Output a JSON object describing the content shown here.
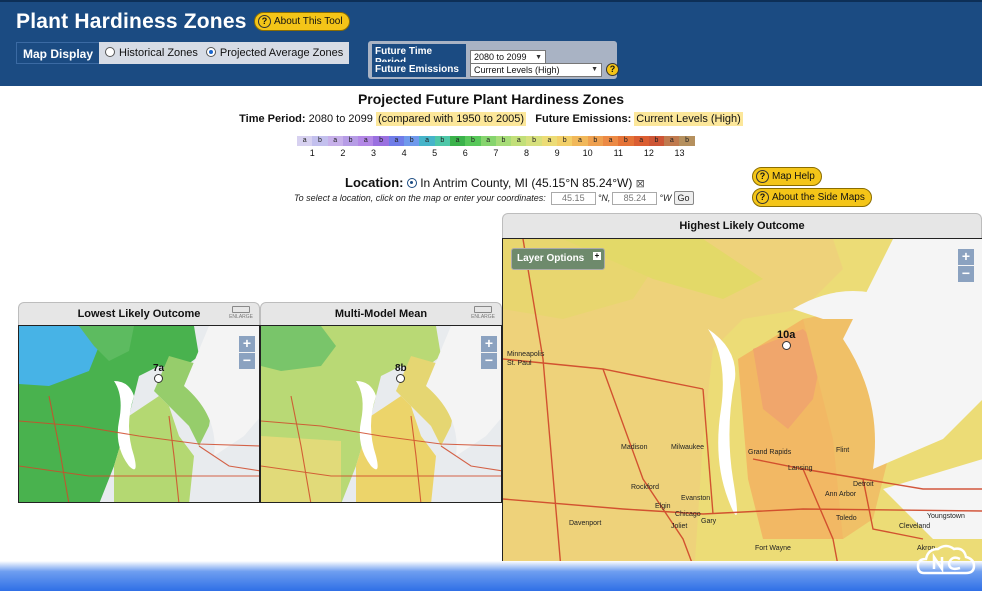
{
  "app": {
    "title": "Plant Hardiness Zones",
    "about_button": "About This Tool"
  },
  "map_display": {
    "label": "Map Display",
    "options": [
      "Historical Zones",
      "Projected Average Zones"
    ],
    "selected": "Projected Average Zones"
  },
  "future": {
    "time_period_label": "Future Time Period",
    "time_period_value": "2080 to 2099",
    "emissions_label": "Future Emissions",
    "emissions_value": "Current Levels (High)"
  },
  "main": {
    "title": "Projected Future Plant Hardiness Zones",
    "period_label": "Time Period:",
    "period_value": "2080 to 2099",
    "compared": "(compared with 1950 to 2005)",
    "emissions_label": "Future Emissions:",
    "emissions_value": "Current Levels (High)"
  },
  "legend": {
    "subzones": [
      "a",
      "b",
      "a",
      "b",
      "a",
      "b",
      "a",
      "b",
      "a",
      "b",
      "a",
      "b",
      "a",
      "b",
      "a",
      "b",
      "a",
      "b",
      "a",
      "b",
      "a",
      "b",
      "a",
      "b",
      "a",
      "b"
    ],
    "numbers": [
      "1",
      "2",
      "3",
      "4",
      "5",
      "6",
      "7",
      "8",
      "9",
      "10",
      "11",
      "12",
      "13"
    ],
    "colors": [
      "#d7d1f0",
      "#c3c0ee",
      "#c7b0ea",
      "#b69ce6",
      "#b387e6",
      "#9a70e0",
      "#6f7ce8",
      "#6f99ec",
      "#46b4c9",
      "#4ec7a8",
      "#3bb24b",
      "#58c85a",
      "#86d46e",
      "#a7dc78",
      "#c2df79",
      "#d7e07d",
      "#ecdc76",
      "#f2cf68",
      "#f1b85a",
      "#eea04f",
      "#ec8a45",
      "#e57337",
      "#db5e32",
      "#cd5535",
      "#c07a4e",
      "#b5905e"
    ]
  },
  "location": {
    "label": "Location:",
    "value": "In Antrim County, MI (45.15°N 85.24°W)",
    "instruction": "To select a location, click on the map or enter your coordinates:",
    "lat_placeholder": "45.15",
    "lat_unit": "°N,",
    "lon_placeholder": "85.24",
    "lon_unit": "°W",
    "go": "Go"
  },
  "help": {
    "map_help": "Map Help",
    "side_maps": "About the Side Maps"
  },
  "panels": {
    "lowest": {
      "title": "Lowest Likely Outcome",
      "zone": "7a",
      "enlarge": "ENLARGE"
    },
    "mean": {
      "title": "Multi-Model Mean",
      "zone": "8b",
      "enlarge": "ENLARGE"
    },
    "highest": {
      "title": "Highest Likely Outcome",
      "zone": "10a",
      "layer_options": "Layer Options"
    }
  },
  "zoom": {
    "plus": "+",
    "minus": "−"
  },
  "cities": [
    "Minneapolis",
    "St. Paul",
    "Madison",
    "Milwaukee",
    "Rockford",
    "Elgin",
    "Evanston",
    "Chicago",
    "Joliet",
    "Gary",
    "Davenport",
    "Grand Rapids",
    "Lansing",
    "Flint",
    "Detroit",
    "Ann Arbor",
    "Toledo",
    "Cleveland",
    "Akron",
    "Youngstown",
    "Fort Wayne"
  ],
  "icons": {
    "question": "question-mark-icon",
    "location": "location-pin-icon",
    "clear": "clear-box-icon",
    "enlarge": "enlarge-icon"
  }
}
